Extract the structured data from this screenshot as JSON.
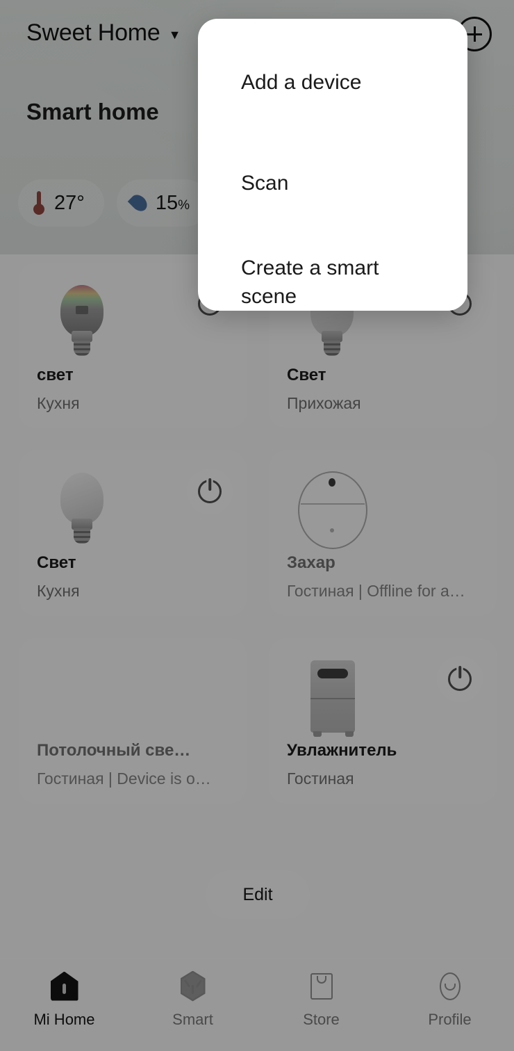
{
  "header": {
    "home_name": "Sweet Home",
    "caret_icon": "chevron-down-icon",
    "add_icon": "plus-circle-icon",
    "section_title": "Smart home"
  },
  "environment": {
    "temperature": {
      "icon": "thermometer-icon",
      "value": "27",
      "unit": "°",
      "color": "#c0392b"
    },
    "humidity": {
      "icon": "water-drop-icon",
      "value": "15",
      "unit": "%",
      "color": "#2f72c2"
    }
  },
  "devices": [
    {
      "name": "свет",
      "room": "Кухня",
      "art": "rgb-bulb",
      "has_toggle": true,
      "dim": false
    },
    {
      "name": "Свет",
      "room": "Прихожая",
      "art": "white-bulb",
      "has_toggle": true,
      "dim": false
    },
    {
      "name": "Свет",
      "room": "Кухня",
      "art": "white-bulb",
      "has_toggle": true,
      "dim": false
    },
    {
      "name": "Захар",
      "room": "Гостиная | Offline for a…",
      "art": "robot-vacuum",
      "has_toggle": false,
      "dim": true
    },
    {
      "name": "Потолочный све…",
      "room": "Гостиная | Device is o…",
      "art": "none",
      "has_toggle": false,
      "dim": true
    },
    {
      "name": "Увлажнитель",
      "room": "Гостиная",
      "art": "humidifier",
      "has_toggle": true,
      "dim": false
    }
  ],
  "edit": {
    "label": "Edit"
  },
  "tabbar": [
    {
      "label": "Mi Home",
      "icon": "home-icon",
      "active": true
    },
    {
      "label": "Smart",
      "icon": "hexagon-smart-icon",
      "active": false
    },
    {
      "label": "Store",
      "icon": "shopping-bag-icon",
      "active": false
    },
    {
      "label": "Profile",
      "icon": "profile-face-icon",
      "active": false
    }
  ],
  "popup": {
    "items": [
      {
        "label": "Add a device"
      },
      {
        "label": "Scan"
      },
      {
        "label": "Create a smart scene"
      }
    ]
  },
  "colors": {
    "hero": "#d6e0da",
    "overlay": "#989898",
    "popup_bg": "#ffffff",
    "accent_text": "#1a1a1a"
  }
}
